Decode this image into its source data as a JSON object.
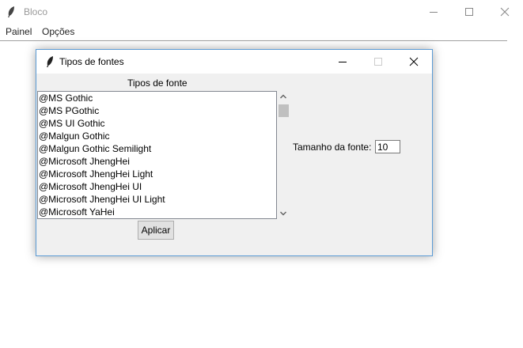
{
  "window": {
    "title": "Bloco"
  },
  "menu": {
    "items": [
      "Painel",
      "Opções"
    ]
  },
  "dialog": {
    "title": "Tipos de fontes",
    "list_heading": "Tipos de fonte",
    "fonts": [
      "@MS Gothic",
      "@MS PGothic",
      "@MS UI Gothic",
      "@Malgun Gothic",
      "@Malgun Gothic Semilight",
      "@Microsoft JhengHei",
      "@Microsoft JhengHei Light",
      "@Microsoft JhengHei UI",
      "@Microsoft JhengHei UI Light",
      "@Microsoft YaHei"
    ],
    "apply_label": "Aplicar",
    "size_label": "Tamanho da fonte:",
    "size_value": "10"
  },
  "icons": {
    "app": "feather-icon",
    "minimize": "minimize-icon",
    "maximize": "maximize-icon",
    "close": "close-icon",
    "scroll_up": "chevron-up-icon",
    "scroll_down": "chevron-down-icon"
  },
  "colors": {
    "dialog_border": "#5b9bd5",
    "disabled_text": "#999999"
  }
}
